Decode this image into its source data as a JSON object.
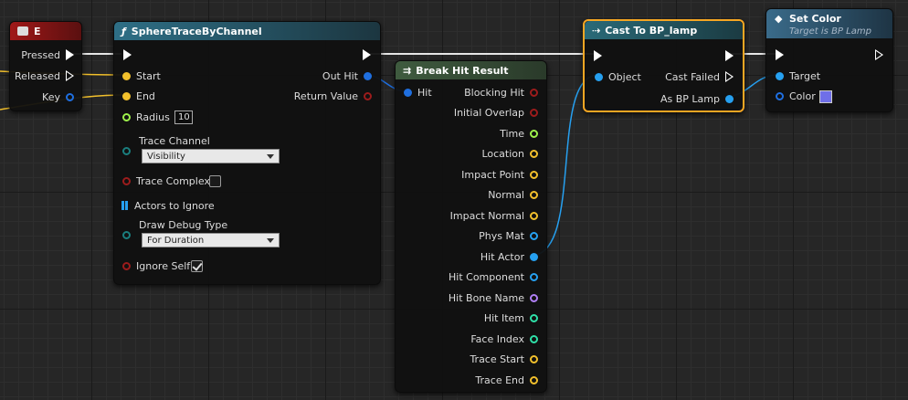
{
  "colors": {
    "exec": "#ffffff",
    "vector": "#f2c02c",
    "float": "#9ef24b",
    "object": "#26a0f0",
    "struct": "#1f6fe0",
    "bool": "#9c1c1c",
    "channel": "#1a7f7f",
    "name": "#b07ff5",
    "int": "#2fe0a8",
    "color_swatch": "#6f6fe8"
  },
  "event_node": {
    "title": "E",
    "pins": [
      "Pressed",
      "Released",
      "Key"
    ]
  },
  "trace_node": {
    "title": "SphereTraceByChannel",
    "title_icon": "function-icon",
    "inputs": {
      "start": "Start",
      "end": "End",
      "radius": "Radius",
      "radius_value": "10",
      "trace_channel": "Trace Channel",
      "trace_channel_value": "Visibility",
      "trace_complex": "Trace Complex",
      "actors_to_ignore": "Actors to Ignore",
      "draw_debug_type": "Draw Debug Type",
      "draw_debug_value": "For Duration",
      "ignore_self": "Ignore Self"
    },
    "outputs": {
      "out_hit": "Out Hit",
      "return_value": "Return Value"
    }
  },
  "break_node": {
    "title": "Break Hit Result",
    "input": "Hit",
    "outputs": [
      {
        "label": "Blocking Hit",
        "type": "bool"
      },
      {
        "label": "Initial Overlap",
        "type": "bool"
      },
      {
        "label": "Time",
        "type": "float"
      },
      {
        "label": "Location",
        "type": "vector"
      },
      {
        "label": "Impact Point",
        "type": "vector"
      },
      {
        "label": "Normal",
        "type": "vector"
      },
      {
        "label": "Impact Normal",
        "type": "vector"
      },
      {
        "label": "Phys Mat",
        "type": "object"
      },
      {
        "label": "Hit Actor",
        "type": "object"
      },
      {
        "label": "Hit Component",
        "type": "object"
      },
      {
        "label": "Hit Bone Name",
        "type": "name"
      },
      {
        "label": "Hit Item",
        "type": "int"
      },
      {
        "label": "Face Index",
        "type": "int"
      },
      {
        "label": "Trace Start",
        "type": "vector"
      },
      {
        "label": "Trace End",
        "type": "vector"
      }
    ]
  },
  "cast_node": {
    "title": "Cast To BP_lamp",
    "object": "Object",
    "cast_failed": "Cast Failed",
    "as_bp_lamp": "As BP Lamp"
  },
  "set_color_node": {
    "title": "Set Color",
    "subtitle": "Target is BP Lamp",
    "target": "Target",
    "color": "Color"
  }
}
